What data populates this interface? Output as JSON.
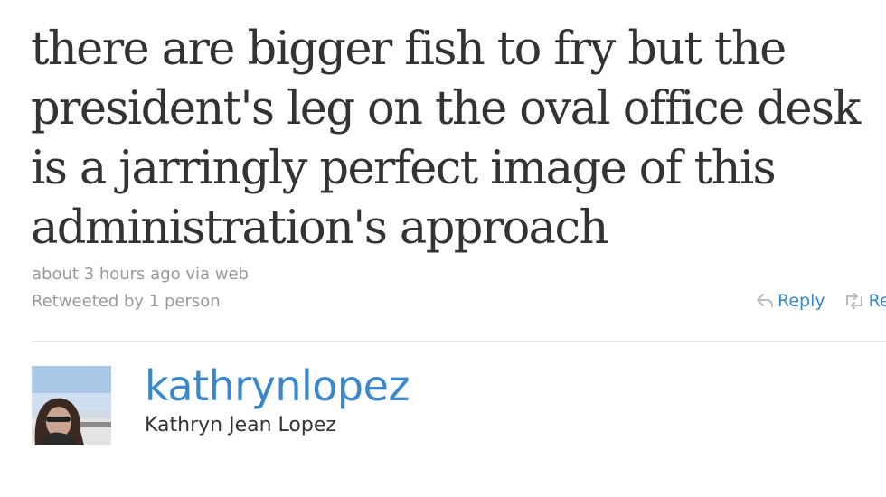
{
  "tweet": {
    "text": "there are bigger fish to fry but the president's leg on the oval office desk is a jarringly perfect image of this administration's approach",
    "timestamp": "about 3 hours ago via web",
    "retweeted_by": "Retweeted by 1 person"
  },
  "actions": {
    "reply_label": "Reply",
    "retweet_label": "Re"
  },
  "author": {
    "screen_name": "kathrynlopez",
    "full_name": "Kathryn Jean Lopez"
  },
  "icons": {
    "reply": "reply-arrow-icon",
    "retweet": "retweet-arrows-icon"
  },
  "colors": {
    "link": "#3a87c9",
    "text": "#333333",
    "meta": "#999999",
    "icon": "#bbbbbb"
  }
}
